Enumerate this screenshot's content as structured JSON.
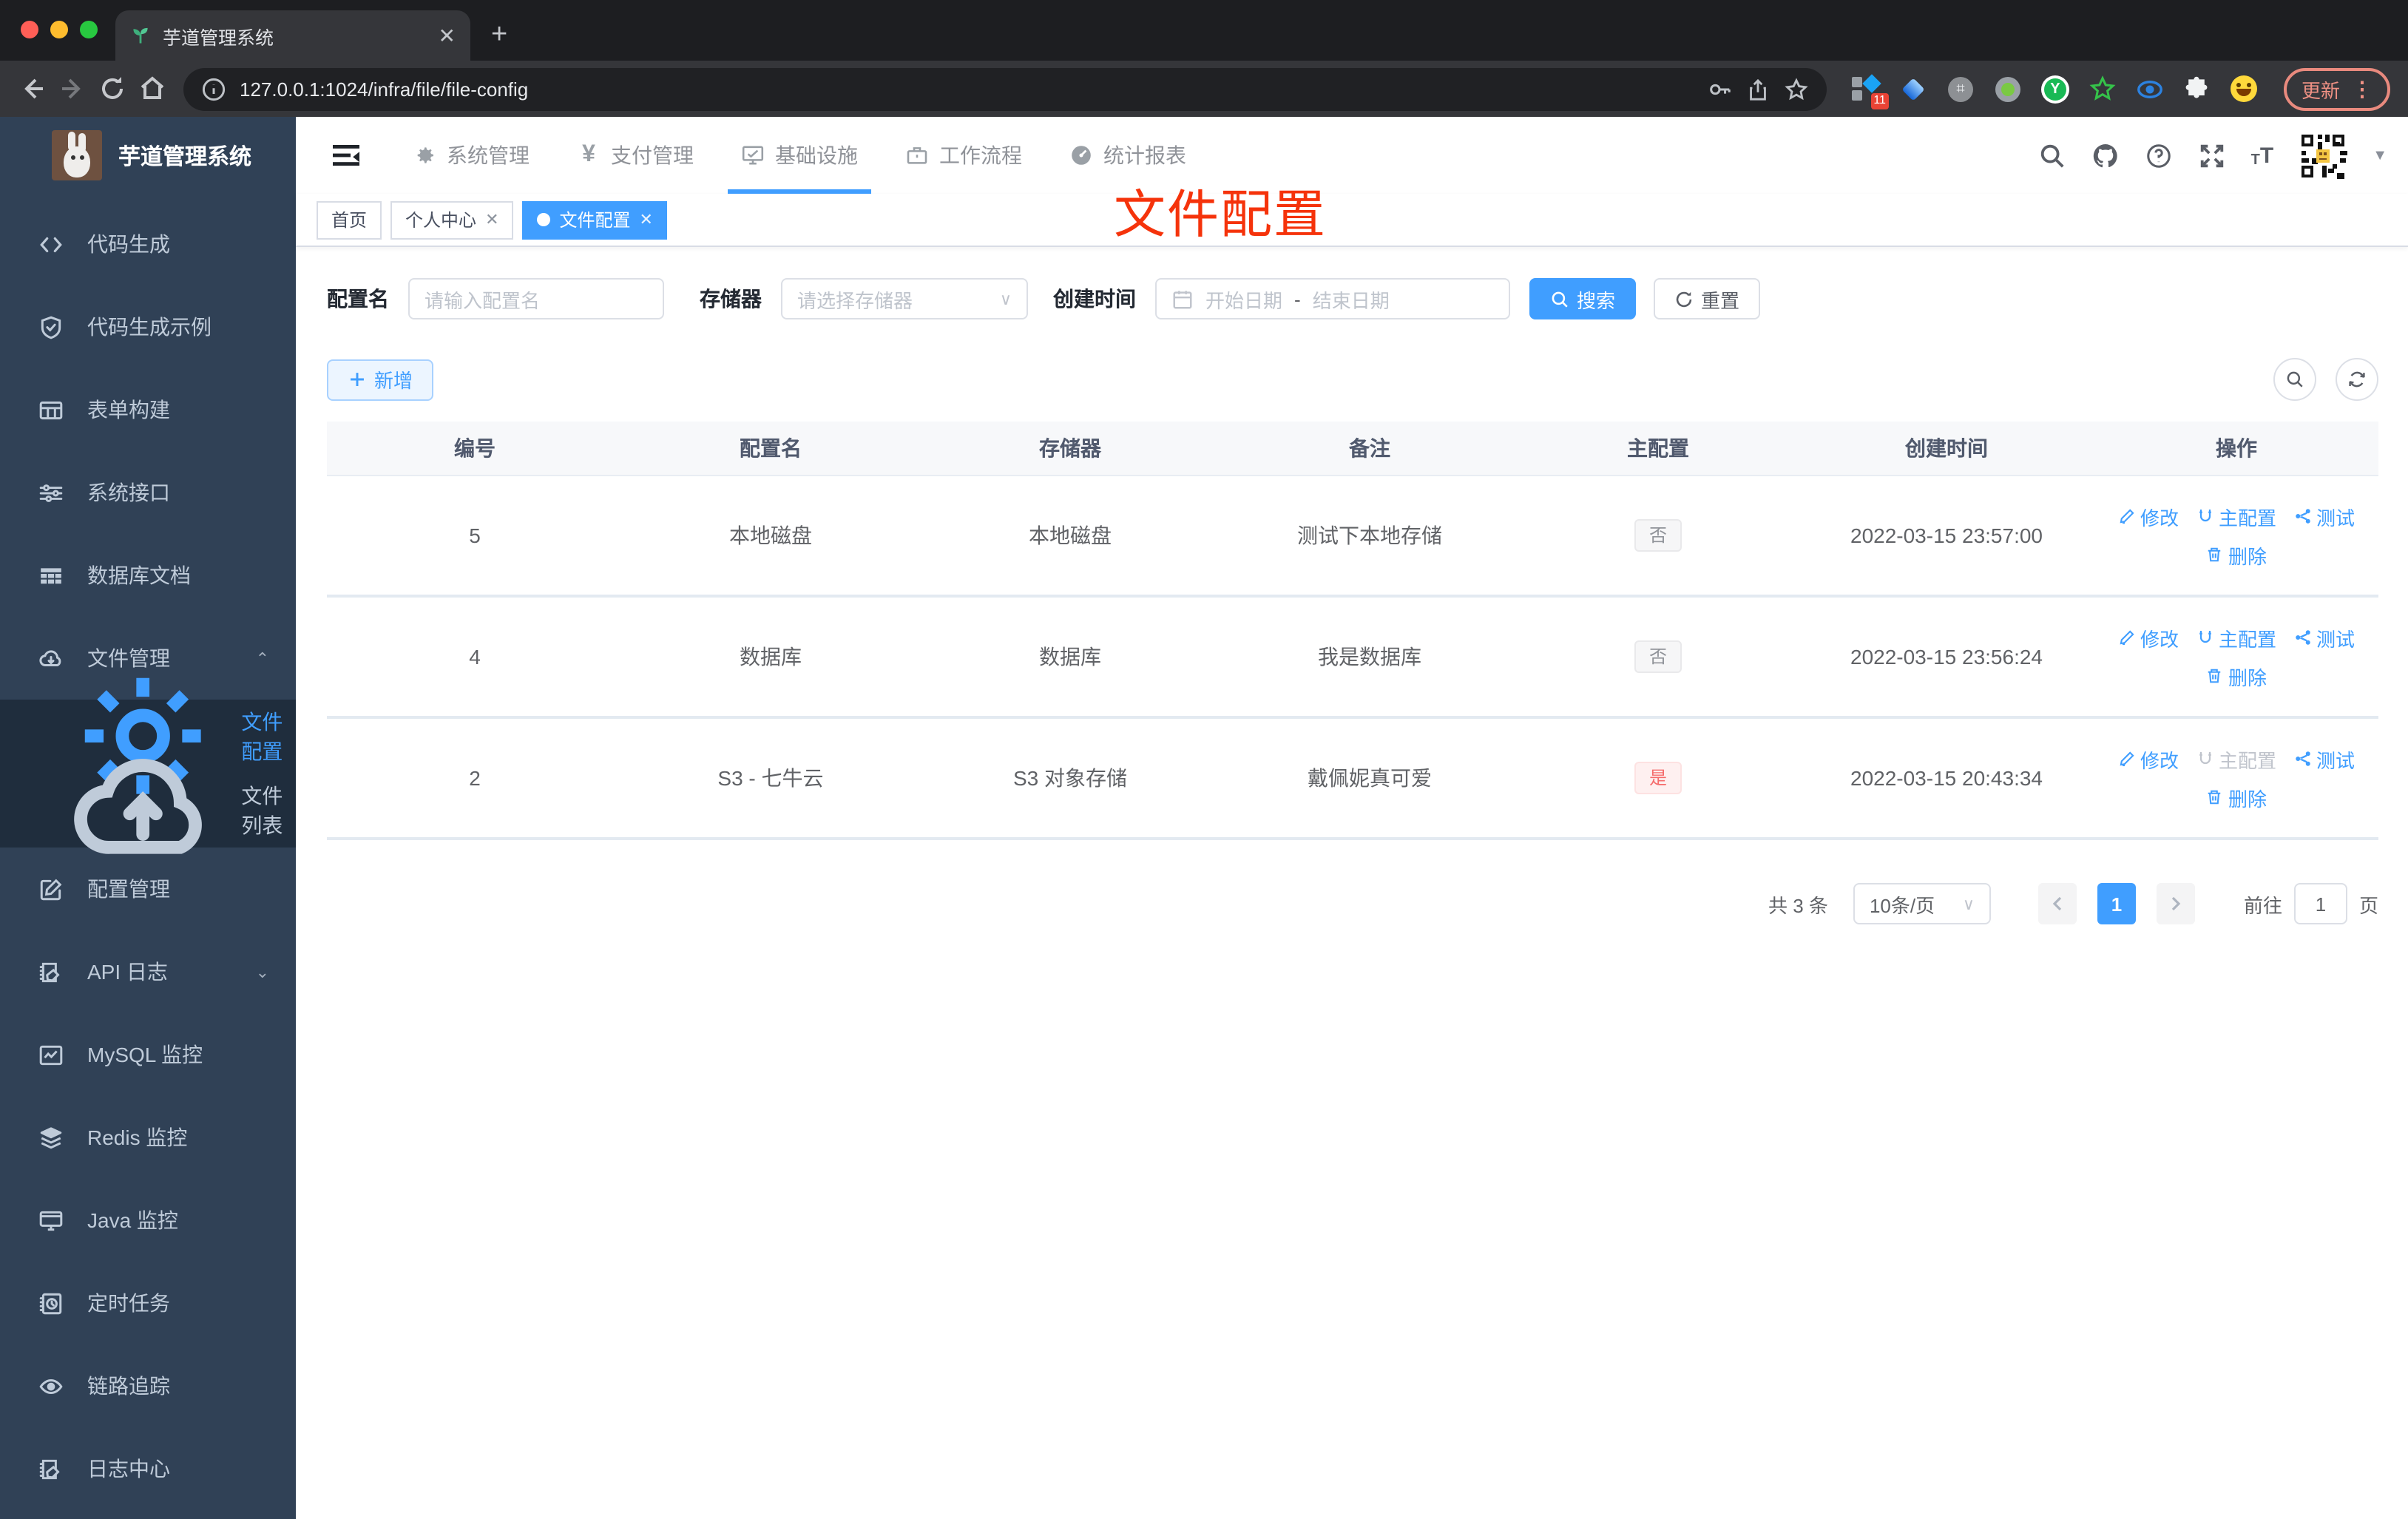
{
  "colors": {
    "accent": "#409eff",
    "danger": "#f56c6c",
    "annotation_red": "#f5330b",
    "sidebar_bg": "#304156",
    "submenu_bg": "#1f2d3d"
  },
  "browser": {
    "tab_title": "芋道管理系统",
    "url": "127.0.0.1:1024/infra/file/file-config",
    "update_label": "更新",
    "extension_badge": "11",
    "icons": {
      "favicon": "sprout",
      "profile": "smiley"
    }
  },
  "sidebar": {
    "title": "芋道管理系统",
    "items": [
      {
        "label": "代码生成"
      },
      {
        "label": "代码生成示例"
      },
      {
        "label": "表单构建"
      },
      {
        "label": "系统接口"
      },
      {
        "label": "数据库文档"
      },
      {
        "label": "文件管理",
        "expanded": true,
        "children": [
          {
            "label": "文件配置",
            "active": true
          },
          {
            "label": "文件列表"
          }
        ]
      },
      {
        "label": "配置管理"
      },
      {
        "label": "API 日志",
        "collapsed": true
      },
      {
        "label": "MySQL 监控"
      },
      {
        "label": "Redis 监控"
      },
      {
        "label": "Java 监控"
      },
      {
        "label": "定时任务"
      },
      {
        "label": "链路追踪"
      },
      {
        "label": "日志中心"
      }
    ]
  },
  "topnav": {
    "items": [
      {
        "label": "系统管理"
      },
      {
        "label": "支付管理"
      },
      {
        "label": "基础设施",
        "active": true
      },
      {
        "label": "工作流程"
      },
      {
        "label": "统计报表"
      }
    ]
  },
  "tabs": [
    {
      "label": "首页"
    },
    {
      "label": "个人中心",
      "closable": true
    },
    {
      "label": "文件配置",
      "active": true,
      "closable": true
    }
  ],
  "annotation": "文件配置",
  "filters": {
    "name_label": "配置名",
    "name_placeholder": "请输入配置名",
    "storage_label": "存储器",
    "storage_placeholder": "请选择存储器",
    "time_label": "创建时间",
    "start_placeholder": "开始日期",
    "range_separator": "-",
    "end_placeholder": "结束日期",
    "search_label": "搜索",
    "reset_label": "重置"
  },
  "toolbar": {
    "add_label": "新增"
  },
  "table": {
    "columns": [
      "编号",
      "配置名",
      "存储器",
      "备注",
      "主配置",
      "创建时间",
      "操作"
    ],
    "action_labels": {
      "edit": "修改",
      "master": "主配置",
      "test": "测试",
      "del": "删除"
    },
    "rows": [
      {
        "id": "5",
        "name": "本地磁盘",
        "storage": "本地磁盘",
        "remark": "测试下本地存储",
        "master": "否",
        "created": "2022-03-15 23:57:00"
      },
      {
        "id": "4",
        "name": "数据库",
        "storage": "数据库",
        "remark": "我是数据库",
        "master": "否",
        "created": "2022-03-15 23:56:24"
      },
      {
        "id": "2",
        "name": "S3 - 七牛云",
        "storage": "S3 对象存储",
        "remark": "戴佩妮真可爱",
        "master": "是",
        "created": "2022-03-15 20:43:34"
      }
    ]
  },
  "pagination": {
    "total": "共 3 条",
    "page_size": "10条/页",
    "current_page": "1",
    "goto_label": "前往",
    "goto_value": "1",
    "page_unit": "页"
  }
}
